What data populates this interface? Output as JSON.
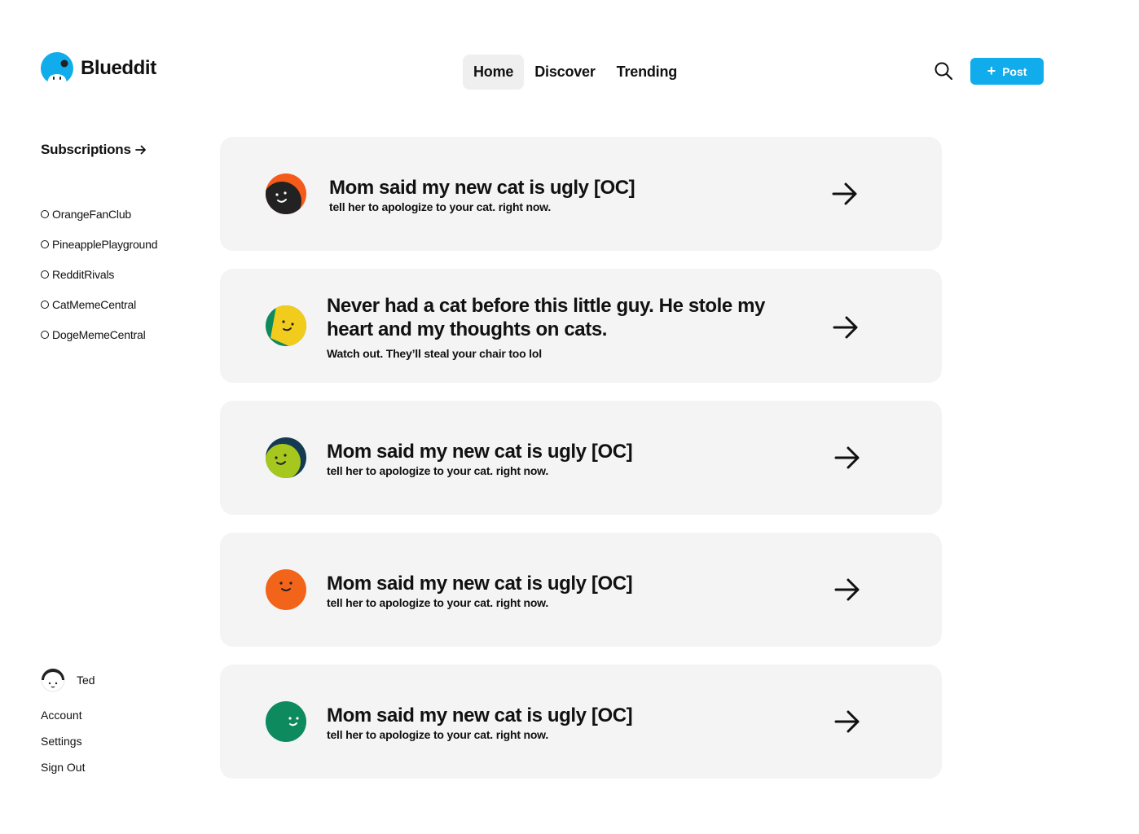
{
  "app": {
    "name": "Blueddit",
    "logo_icon": "blueddit-logo-icon"
  },
  "nav": {
    "tabs": [
      {
        "label": "Home",
        "active": true
      },
      {
        "label": "Discover",
        "active": false
      },
      {
        "label": "Trending",
        "active": false
      }
    ]
  },
  "header": {
    "search_icon": "search-icon",
    "post_label": "Post",
    "accent_color": "#10acec"
  },
  "sidebar": {
    "subscriptions_label": "Subscriptions",
    "subscriptions": [
      "OrangeFanClub",
      "PineapplePlayground",
      "RedditRivals",
      "CatMemeCentral",
      "DogeMemeCentral"
    ],
    "user": {
      "name": "Ted"
    },
    "account_links": [
      "Account",
      "Settings",
      "Sign Out"
    ]
  },
  "feed": [
    {
      "title": "Mom said my new cat is ugly [OC]",
      "subtitle": "tell her to apologize to your cat. right now.",
      "avatar_colors": [
        "#f45b1a",
        "#222222"
      ]
    },
    {
      "title": "Never had a cat before this little guy. He stole my heart and my thoughts on cats.",
      "subtitle": "Watch out. They’ll steal your chair too lol",
      "avatar_colors": [
        "#0e8a5f",
        "#f2cc1c"
      ]
    },
    {
      "title": "Mom said my new cat is ugly [OC]",
      "subtitle": "tell her to apologize to your cat. right now.",
      "avatar_colors": [
        "#163a52",
        "#a6c81e"
      ]
    },
    {
      "title": "Mom said my new cat is ugly [OC]",
      "subtitle": "tell her to apologize to your cat. right now.",
      "avatar_colors": [
        "#f26419",
        "#f26419"
      ]
    },
    {
      "title": "Mom said my new cat is ugly [OC]",
      "subtitle": "tell her to apologize to your cat. right now.",
      "avatar_colors": [
        "#0e8a5f",
        "#0e8a5f"
      ]
    }
  ]
}
